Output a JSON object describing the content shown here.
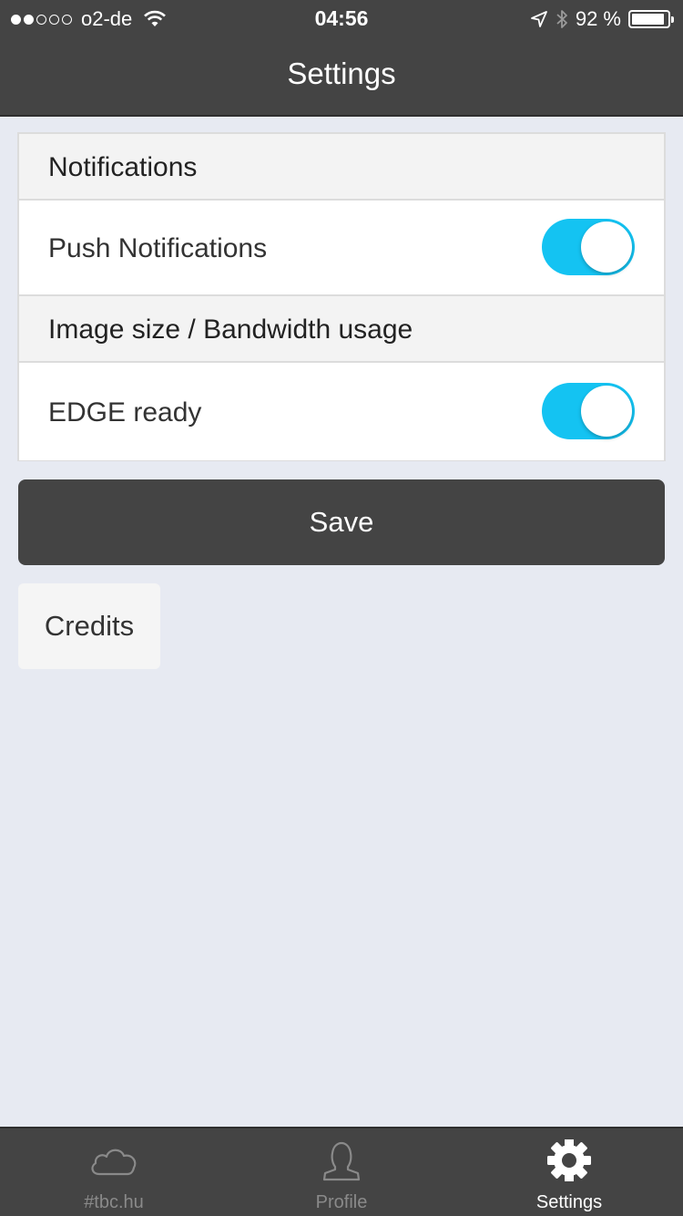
{
  "status_bar": {
    "carrier": "o2-de",
    "time": "04:56",
    "battery": "92 %",
    "battery_level": 0.92,
    "signal_bars_filled": 2,
    "signal_bars_total": 5
  },
  "nav": {
    "title": "Settings"
  },
  "settings": {
    "sections": [
      {
        "header": "Notifications",
        "item_label": "Push Notifications",
        "toggle_on": true
      },
      {
        "header": "Image size / Bandwidth usage",
        "item_label": "EDGE ready",
        "toggle_on": true
      }
    ]
  },
  "buttons": {
    "save": "Save",
    "credits": "Credits"
  },
  "tabs": [
    {
      "label": "#tbc.hu",
      "icon": "cloud-icon",
      "active": false
    },
    {
      "label": "Profile",
      "icon": "person-icon",
      "active": false
    },
    {
      "label": "Settings",
      "icon": "gear-icon",
      "active": true
    }
  ],
  "colors": {
    "bar_background": "#444444",
    "toggle_on": "#14c3f2",
    "page_background": "#e7eaf2"
  }
}
